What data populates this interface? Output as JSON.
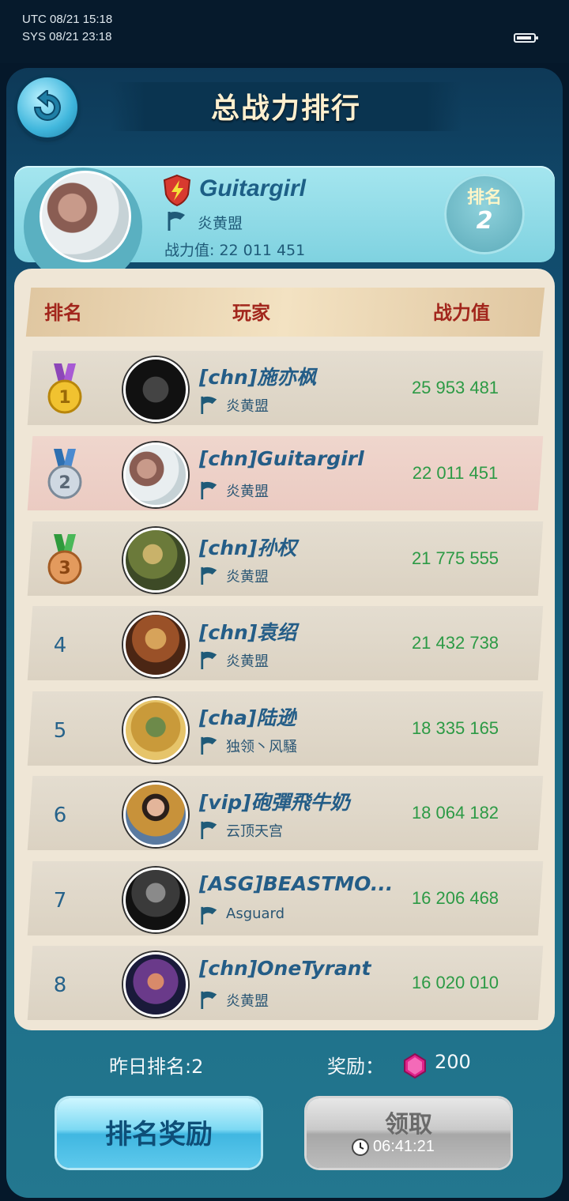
{
  "status_bar": {
    "utc": "UTC 08/21 15:18",
    "sys": "SYS 08/21 23:18"
  },
  "header": {
    "title": "总战力排行",
    "back_icon": "back-arrow-icon"
  },
  "me": {
    "name": "Guitargirl",
    "alliance": "炎黄盟",
    "power_label": "战力值: 22 011 451",
    "rank_label": "排名",
    "rank": "2"
  },
  "table": {
    "headers": {
      "rank": "排名",
      "player": "玩家",
      "power": "战力值"
    },
    "rows": [
      {
        "rank": "1",
        "name": "[chn]施亦枫",
        "alliance": "炎黄盟",
        "power": "25 953 481"
      },
      {
        "rank": "2",
        "name": "[chn]Guitargirl",
        "alliance": "炎黄盟",
        "power": "22 011 451"
      },
      {
        "rank": "3",
        "name": "[chn]孙权",
        "alliance": "炎黄盟",
        "power": "21 775 555"
      },
      {
        "rank": "4",
        "name": "[chn]袁绍",
        "alliance": "炎黄盟",
        "power": "21 432 738"
      },
      {
        "rank": "5",
        "name": "[cha]陆逊",
        "alliance": "独领丶风騷",
        "power": "18 335 165"
      },
      {
        "rank": "6",
        "name": "[vip]砲彈飛牛奶",
        "alliance": "云顶天宫",
        "power": "18 064 182"
      },
      {
        "rank": "7",
        "name": "[ASG]BEASTMO...",
        "alliance": "Asguard",
        "power": "16 206 468"
      },
      {
        "rank": "8",
        "name": "[chn]OneTyrant",
        "alliance": "炎黄盟",
        "power": "16 020 010"
      }
    ]
  },
  "footer": {
    "yesterday_rank": "昨日排名:2",
    "reward_label": "奖励：",
    "reward_amount": "200",
    "rank_reward_button": "排名奖励",
    "claim_button": "领取",
    "timer": "06:41:21"
  },
  "colors": {
    "power_green": "#2c9a45",
    "name_blue": "#245d87",
    "header_red": "#a2261c"
  }
}
